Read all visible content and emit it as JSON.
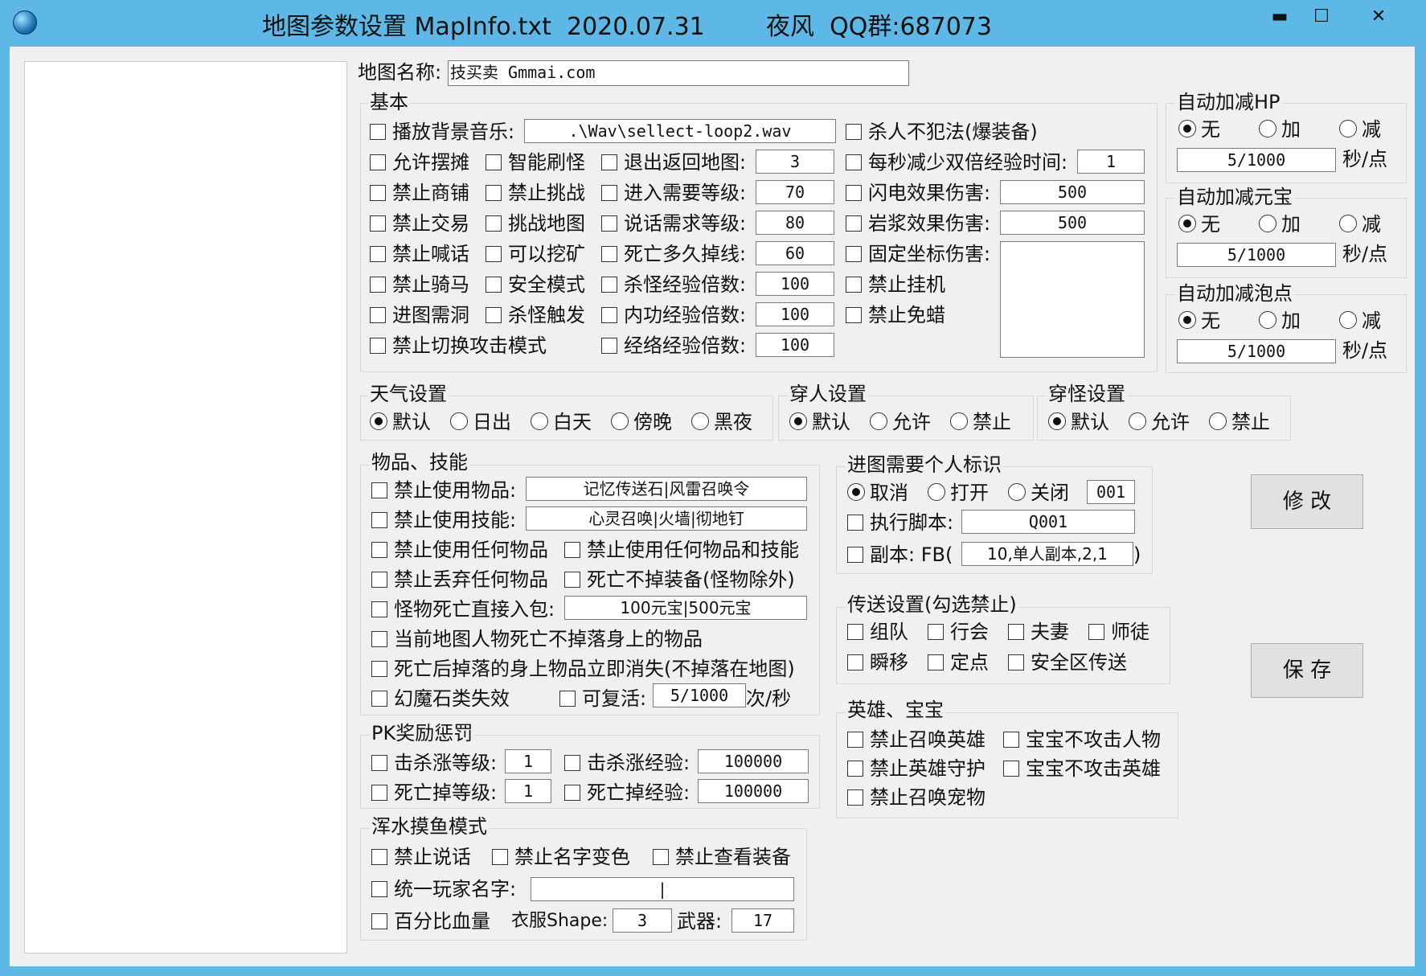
{
  "window": {
    "title": "地图参数设置 MapInfo.txt  2020.07.31        夜风  QQ群:687073",
    "minimize": "▬",
    "maximize": "☐",
    "close": "✕"
  },
  "map_name": {
    "label": "地图名称:",
    "value": "技买卖 Gmmai.com"
  },
  "basic": {
    "title": "基本",
    "bgm_label": "播放背景音乐:",
    "bgm_value": ".\\Wav\\sellect-loop2.wav",
    "pk_free": "杀人不犯法(爆装备)",
    "col1": [
      "允许摆摊",
      "禁止商铺",
      "禁止交易",
      "禁止喊话",
      "禁止骑马",
      "进图需洞",
      "禁止切换攻击模式"
    ],
    "col2": [
      "智能刷怪",
      "禁止挑战",
      "挑战地图",
      "可以挖矿",
      "安全模式",
      "杀怪触发"
    ],
    "col3": [
      {
        "label": "退出返回地图:",
        "value": "3"
      },
      {
        "label": "进入需要等级:",
        "value": "70"
      },
      {
        "label": "说话需求等级:",
        "value": "80"
      },
      {
        "label": "死亡多久掉线:",
        "value": "60"
      },
      {
        "label": "杀怪经验倍数:",
        "value": "100"
      },
      {
        "label": "内功经验倍数:",
        "value": "100"
      },
      {
        "label": "经络经验倍数:",
        "value": "100"
      }
    ],
    "col4": [
      {
        "label": "每秒减少双倍经验时间:",
        "value": "1"
      },
      {
        "label": "闪电效果伤害:",
        "value": "500"
      },
      {
        "label": "岩浆效果伤害:",
        "value": "500"
      },
      {
        "label": "固定坐标伤害:",
        "value": ""
      }
    ],
    "col4_extra": [
      "禁止挂机",
      "禁止免蜡"
    ]
  },
  "auto": [
    {
      "title": "自动加减HP",
      "options": [
        "无",
        "加",
        "减"
      ],
      "value": "5/1000",
      "unit": "秒/点"
    },
    {
      "title": "自动加减元宝",
      "options": [
        "无",
        "加",
        "减"
      ],
      "value": "5/1000",
      "unit": "秒/点"
    },
    {
      "title": "自动加减泡点",
      "options": [
        "无",
        "加",
        "减"
      ],
      "value": "5/1000",
      "unit": "秒/点"
    }
  ],
  "weather": {
    "title": "天气设置",
    "options": [
      "默认",
      "日出",
      "白天",
      "傍晚",
      "黑夜"
    ]
  },
  "pass_player": {
    "title": "穿人设置",
    "options": [
      "默认",
      "允许",
      "禁止"
    ]
  },
  "pass_monster": {
    "title": "穿怪设置",
    "options": [
      "默认",
      "允许",
      "禁止"
    ]
  },
  "items": {
    "title": "物品、技能",
    "forbid_item_label": "禁止使用物品:",
    "forbid_item_value": "记忆传送石|风雷召唤令",
    "forbid_skill_label": "禁止使用技能:",
    "forbid_skill_value": "心灵召唤|火墙|彻地钉",
    "forbid_any_item": "禁止使用任何物品",
    "forbid_any_item_skill": "禁止使用任何物品和技能",
    "forbid_drop_any": "禁止丢弃任何物品",
    "death_no_drop_equip": "死亡不掉装备(怪物除外)",
    "monster_to_bag_label": "怪物死亡直接入包:",
    "monster_to_bag_value": "100元宝|500元宝",
    "no_drop_on_death": "当前地图人物死亡不掉落身上的物品",
    "vanish_on_death": "死亡后掉落的身上物品立即消失(不掉落在地图)",
    "magic_stone": "幻魔石类失效",
    "revive_label": "可复活:",
    "revive_value": "5/1000",
    "revive_unit": "次/秒"
  },
  "pk": {
    "title": "PK奖励惩罚",
    "kill_level": "击杀涨等级:",
    "kill_level_v": "1",
    "kill_exp": "击杀涨经验:",
    "kill_exp_v": "100000",
    "die_level": "死亡掉等级:",
    "die_level_v": "1",
    "die_exp": "死亡掉经验:",
    "die_exp_v": "100000"
  },
  "muddy": {
    "title": "浑水摸鱼模式",
    "no_talk": "禁止说话",
    "no_name_color": "禁止名字变色",
    "no_view_equip": "禁止查看装备",
    "unify_name": "统一玩家名字:",
    "unify_name_v": "|",
    "percent_hp": "百分比血量",
    "cloth_label": "衣服Shape:",
    "cloth_v": "3",
    "weapon_label": "武器:",
    "weapon_v": "17"
  },
  "mark": {
    "title": "进图需要个人标识",
    "options": [
      "取消",
      "打开",
      "关闭"
    ],
    "code": "001",
    "script_label": "执行脚本:",
    "script_v": "Q001",
    "fb_label": "副本: FB(",
    "fb_v": "10,单人副本,2,1",
    "fb_close": ")"
  },
  "teleport": {
    "title": "传送设置(勾选禁止)",
    "items": [
      "组队",
      "行会",
      "夫妻",
      "师徒",
      "瞬移",
      "定点",
      "安全区传送"
    ]
  },
  "hero": {
    "title": "英雄、宝宝",
    "items": [
      "禁止召唤英雄",
      "宝宝不攻击人物",
      "禁止英雄守护",
      "宝宝不攻击英雄",
      "禁止召唤宠物"
    ]
  },
  "buttons": {
    "modify": "修 改",
    "save": "保 存"
  }
}
